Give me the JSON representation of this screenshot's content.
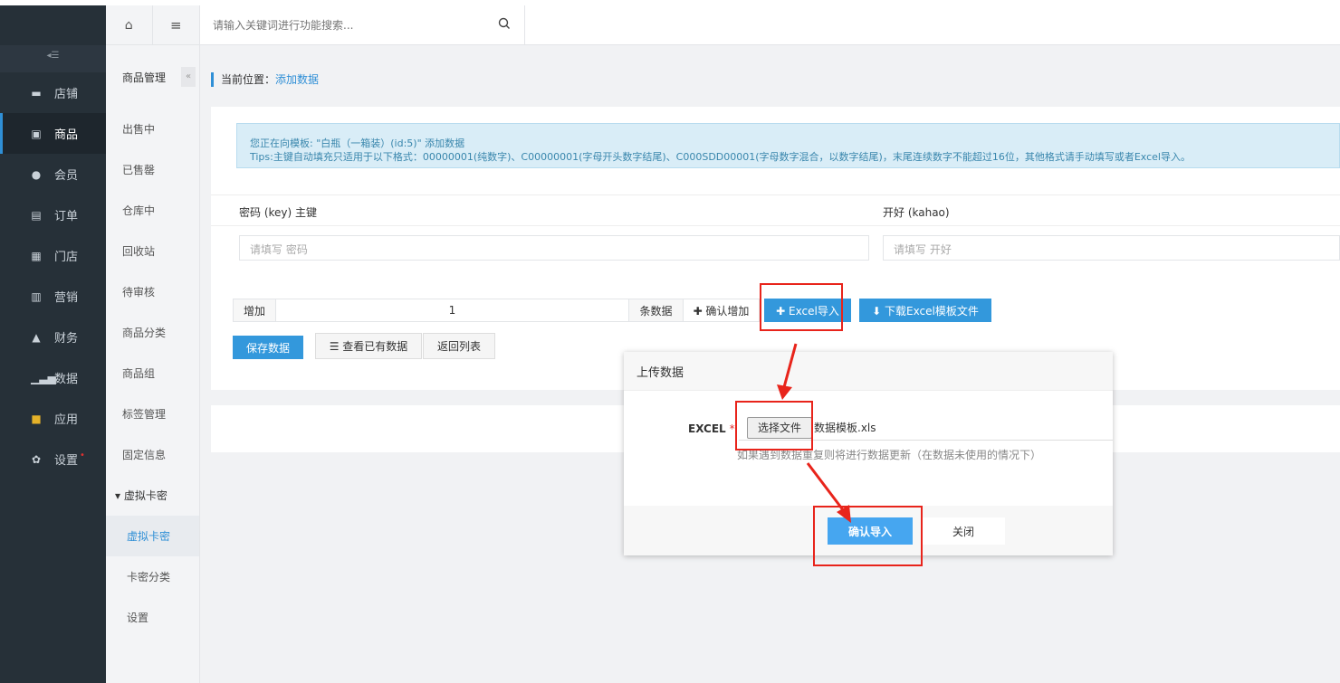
{
  "sidebar": {
    "items": [
      {
        "label": "店铺",
        "icon": "store-icon"
      },
      {
        "label": "商品",
        "icon": "goods-icon"
      },
      {
        "label": "会员",
        "icon": "user-icon"
      },
      {
        "label": "订单",
        "icon": "order-icon"
      },
      {
        "label": "门店",
        "icon": "shop-icon"
      },
      {
        "label": "营销",
        "icon": "gift-icon"
      },
      {
        "label": "财务",
        "icon": "finance-icon"
      },
      {
        "label": "数据",
        "icon": "chart-icon"
      },
      {
        "label": "应用",
        "icon": "apps-icon"
      },
      {
        "label": "设置",
        "icon": "gear-icon"
      }
    ]
  },
  "submenu": {
    "title": "商品管理",
    "items": [
      "出售中",
      "已售罄",
      "仓库中",
      "回收站",
      "待审核",
      "商品分类",
      "商品组",
      "标签管理",
      "固定信息"
    ],
    "group": "▾ 虚拟卡密",
    "children": [
      "虚拟卡密",
      "卡密分类",
      "设置"
    ]
  },
  "search": {
    "placeholder": "请输入关键词进行功能搜索..."
  },
  "breadcrumb": {
    "prefix": "当前位置：",
    "current": "添加数据"
  },
  "tips": {
    "line1": "您正在向模板: \"白瓶（一箱装）(id:5)\" 添加数据",
    "line2": "Tips:主键自动填充只适用于以下格式：00000001(纯数字)、C00000001(字母开头数字结尾)、C000SDD00001(字母数字混合，以数字结尾)，末尾连续数字不能超过16位，其他格式请手动填写或者Excel导入。"
  },
  "fields": {
    "key_label": "密码 (key) 主键",
    "key_placeholder": "请填写 密码",
    "kahao_label": "开好 (kahao)",
    "kahao_placeholder": "请填写 开好"
  },
  "addrow": {
    "add": "增加",
    "count": "1",
    "unit": "条数据",
    "confirm": "✚ 确认增加",
    "excel_import": "✚ Excel导入",
    "download": "⬇ 下载Excel模板文件"
  },
  "actions": {
    "save": "保存数据",
    "view": "☰ 查看已有数据",
    "back": "返回列表"
  },
  "modal": {
    "title": "上传数据",
    "excel_label": "EXCEL",
    "required": "*",
    "choose_file": "选择文件",
    "file_name": "数据模板.xls",
    "hint": "如果遇到数据重复则将进行数据更新（在数据未使用的情况下）",
    "confirm": "确认导入",
    "close": "关闭"
  },
  "colors": {
    "accent": "#3398dc",
    "sidebar": "#263038",
    "annotation": "#e8241b"
  }
}
